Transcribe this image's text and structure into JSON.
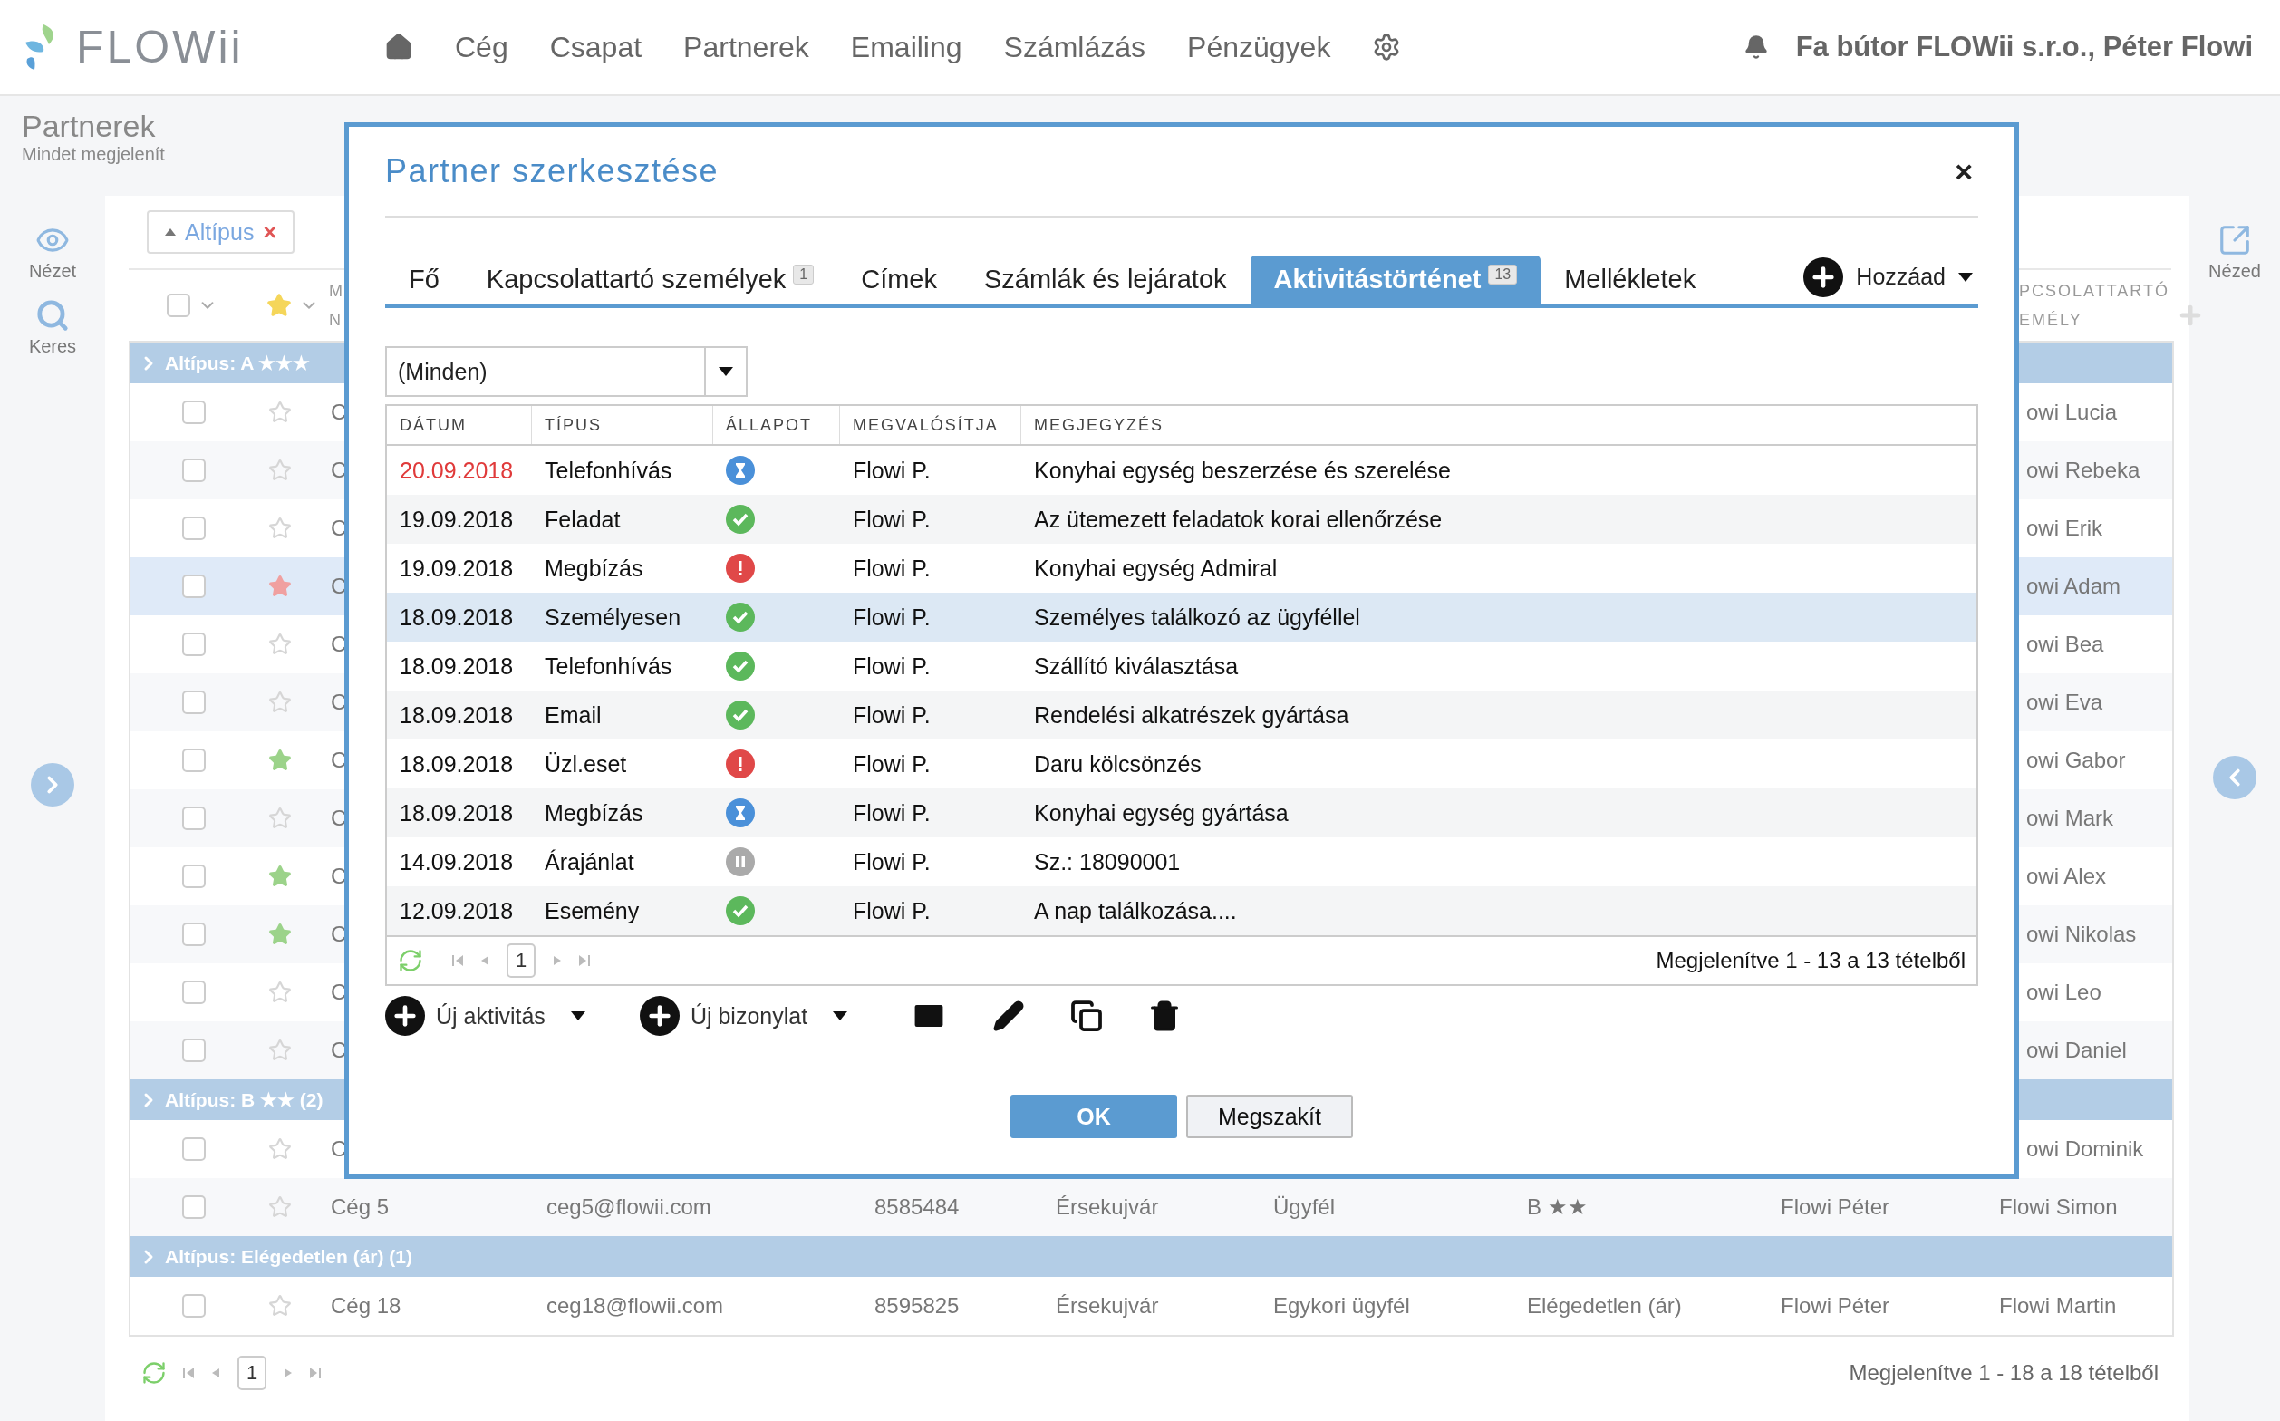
{
  "header": {
    "logo": "FLOWii",
    "nav": [
      {
        "label": "Cég"
      },
      {
        "label": "Csapat"
      },
      {
        "label": "Partnerek"
      },
      {
        "label": "Emailing"
      },
      {
        "label": "Számlázás"
      },
      {
        "label": "Pénzügyek"
      }
    ],
    "user": "Fa bútor FLOWii s.r.o., Péter Flowi"
  },
  "page": {
    "title": "Partnerek",
    "subtitle": "Mindet megjelenít"
  },
  "sidebar_left": [
    {
      "label": "Nézet"
    },
    {
      "label": "Keres"
    }
  ],
  "sidebar_right": [
    {
      "label": "Nézed"
    }
  ],
  "filter_chip": {
    "label": "Altípus",
    "remove": "×"
  },
  "select_all": {
    "checked": false
  },
  "list": {
    "header": {
      "column_3": [
        "M",
        "N"
      ],
      "contact": [
        "PCSOLATTARTÓ",
        "EMÉLY"
      ]
    },
    "groups": [
      {
        "title": "Altípus: A ★★★",
        "rows": [
          {
            "kind": "covered",
            "checked": false,
            "selected": false,
            "name": "C",
            "contact": "owi Lucia"
          },
          {
            "kind": "covered",
            "checked": false,
            "selected": false,
            "name": "C",
            "contact": "owi Rebeka"
          },
          {
            "kind": "covered",
            "checked": false,
            "selected": false,
            "name": "C",
            "contact": "owi Erik"
          },
          {
            "kind": "covered",
            "checked": false,
            "selected": true,
            "color": "#f0a0a0",
            "name": "C",
            "contact": "owi Adam"
          },
          {
            "kind": "covered",
            "checked": false,
            "selected": false,
            "name": "C",
            "contact": "owi Bea"
          },
          {
            "kind": "covered",
            "checked": false,
            "selected": false,
            "name": "C",
            "contact": "owi Eva"
          },
          {
            "kind": "covered",
            "checked": false,
            "selected": false,
            "color": "#9cd38a",
            "name": "C",
            "contact": "owi Gabor"
          },
          {
            "kind": "covered",
            "checked": false,
            "selected": false,
            "name": "C",
            "contact": "owi Mark"
          },
          {
            "kind": "covered",
            "checked": false,
            "selected": false,
            "color": "#9cd38a",
            "name": "C",
            "contact": "owi Alex"
          },
          {
            "kind": "covered",
            "checked": false,
            "selected": false,
            "color": "#9cd38a",
            "name": "C",
            "contact": "owi Nikolas"
          },
          {
            "kind": "covered",
            "checked": false,
            "selected": false,
            "name": "C",
            "contact": "owi Leo"
          },
          {
            "kind": "covered",
            "checked": false,
            "selected": false,
            "name": "C",
            "contact": "owi Daniel"
          }
        ]
      },
      {
        "title": "Altípus: B ★★ (2)",
        "rows": [
          {
            "kind": "covered",
            "checked": false,
            "selected": false,
            "name": "C",
            "contact": "owi Dominik"
          },
          {
            "kind": "full",
            "checked": false,
            "selected": false,
            "cells": [
              "Cég 5",
              "ceg5@flowii.com",
              "8585484",
              "Érsekujvár",
              "Ügyfél",
              "B ★★",
              "Flowi Péter",
              "Flowi Simon"
            ]
          }
        ]
      },
      {
        "title": "Altípus: Elégedetlen (ár) (1)",
        "rows": [
          {
            "kind": "full",
            "checked": false,
            "selected": false,
            "cells": [
              "Cég 18",
              "ceg18@flowii.com",
              "8595825",
              "Érsekujvár",
              "Egykori ügyfél",
              "Elégedetlen (ár)",
              "Flowi Péter",
              "Flowi Martin"
            ]
          }
        ]
      }
    ],
    "pager": {
      "page": "1",
      "summary": "Megjelenítve 1 - 18 a 18 tételből"
    }
  },
  "dialog": {
    "title": "Partner szerkesztése",
    "close": "×",
    "tabs": [
      {
        "label": "Fő",
        "selected": false
      },
      {
        "label": "Kapcsolattartó személyek",
        "badge": "1",
        "selected": false
      },
      {
        "label": "Címek",
        "selected": false
      },
      {
        "label": "Számlák és lejáratok",
        "selected": false
      },
      {
        "label": "Aktivitástörténet",
        "badge": "13",
        "selected": true
      },
      {
        "label": "Mellékletek",
        "selected": false
      }
    ],
    "add_button": "Hozzáad",
    "filter": {
      "value": "(Minden)"
    },
    "table": {
      "columns": [
        "DÁTUM",
        "TÍPUS",
        "ÁLLAPOT",
        "MEGVALÓSÍTJA",
        "MEGJEGYZÉS"
      ],
      "rows": [
        {
          "date": "20.09.2018",
          "overdue": true,
          "type": "Telefonhívás",
          "kind": "pending",
          "by": "Flowi P.",
          "note": "Konyhai egység beszerzése és szerelése",
          "selected": false
        },
        {
          "date": "19.09.2018",
          "overdue": false,
          "type": "Feladat",
          "kind": "done",
          "by": "Flowi P.",
          "note": "Az ütemezett feladatok korai ellenőrzése",
          "selected": false
        },
        {
          "date": "19.09.2018",
          "overdue": false,
          "type": "Megbízás",
          "kind": "alert",
          "by": "Flowi P.",
          "note": "Konyhai egység Admiral",
          "selected": false
        },
        {
          "date": "18.09.2018",
          "overdue": false,
          "type": "Személyesen",
          "kind": "done",
          "by": "Flowi P.",
          "note": "Személyes találkozó az ügyféllel",
          "selected": true
        },
        {
          "date": "18.09.2018",
          "overdue": false,
          "type": "Telefonhívás",
          "kind": "done",
          "by": "Flowi P.",
          "note": "Szállító kiválasztása",
          "selected": false
        },
        {
          "date": "18.09.2018",
          "overdue": false,
          "type": "Email",
          "kind": "done",
          "by": "Flowi P.",
          "note": "Rendelési alkatrészek gyártása",
          "selected": false
        },
        {
          "date": "18.09.2018",
          "overdue": false,
          "type": "Üzl.eset",
          "kind": "alert",
          "by": "Flowi P.",
          "note": "Daru kölcsönzés",
          "selected": false
        },
        {
          "date": "18.09.2018",
          "overdue": false,
          "type": "Megbízás",
          "kind": "pending",
          "by": "Flowi P.",
          "note": "Konyhai egység gyártása",
          "selected": false
        },
        {
          "date": "14.09.2018",
          "overdue": false,
          "type": "Árajánlat",
          "kind": "paused",
          "by": "Flowi P.",
          "note": "Sz.: 18090001",
          "selected": false
        },
        {
          "date": "12.09.2018",
          "overdue": false,
          "type": "Esemény",
          "kind": "done",
          "by": "Flowi P.",
          "note": "A nap találkozása....",
          "selected": false
        }
      ],
      "pager": {
        "page": "1",
        "summary": "Megjelenítve 1 - 13 a 13 tételből"
      }
    },
    "actions": [
      {
        "label": "Új aktivitás"
      },
      {
        "label": "Új bizonylat"
      }
    ],
    "buttons": [
      {
        "label": "OK",
        "kind": "primary"
      },
      {
        "label": "Megszakít",
        "kind": "secondary"
      }
    ]
  }
}
